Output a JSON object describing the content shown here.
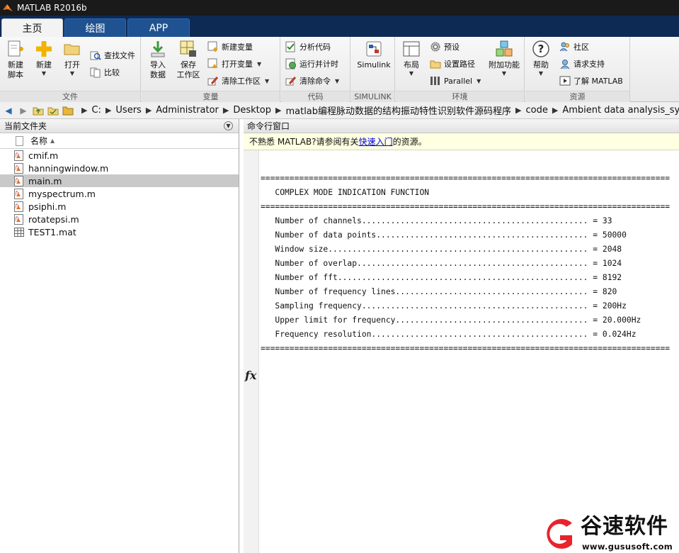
{
  "window": {
    "title": "MATLAB R2016b"
  },
  "tabs": [
    {
      "label": "主页",
      "active": true
    },
    {
      "label": "绘图",
      "active": false
    },
    {
      "label": "APP",
      "active": false
    }
  ],
  "ribbon": {
    "file": {
      "label": "文件",
      "new_script": "新建\n脚本",
      "new": "新建",
      "open": "打开",
      "find_files": "查找文件",
      "compare": "比较"
    },
    "variable": {
      "label": "变量",
      "import": "导入\n数据",
      "save_workspace": "保存\n工作区",
      "new_variable": "新建变量",
      "open_variable": "打开变量",
      "clear_workspace": "清除工作区"
    },
    "code": {
      "label": "代码",
      "analyze": "分析代码",
      "run_time": "运行并计时",
      "clear_commands": "清除命令"
    },
    "simulink": {
      "label": "SIMULINK",
      "simulink": "Simulink"
    },
    "environment": {
      "label": "环境",
      "layout": "布局",
      "preferences": "预设",
      "set_path": "设置路径",
      "parallel": "Parallel",
      "addons": "附加功能"
    },
    "resources": {
      "label": "资源",
      "help": "帮助",
      "community": "社区",
      "support": "请求支持",
      "learn": "了解 MATLAB"
    }
  },
  "path": [
    "C:",
    "Users",
    "Administrator",
    "Desktop",
    "matlab编程脉动数据的结构振动特性识别软件源码程序",
    "code",
    "Ambient data analysis_system ID"
  ],
  "current_folder": {
    "title": "当前文件夹",
    "column_name": "名称",
    "files": [
      {
        "name": "cmif.m",
        "type": "m",
        "selected": false
      },
      {
        "name": "hanningwindow.m",
        "type": "m",
        "selected": false
      },
      {
        "name": "main.m",
        "type": "m",
        "selected": true
      },
      {
        "name": "myspectrum.m",
        "type": "m",
        "selected": false
      },
      {
        "name": "psiphi.m",
        "type": "m",
        "selected": false
      },
      {
        "name": "rotatepsi.m",
        "type": "m",
        "selected": false
      },
      {
        "name": "TEST1.mat",
        "type": "mat",
        "selected": false
      }
    ]
  },
  "command_window": {
    "title": "命令行窗口",
    "notice_prefix": "不熟悉 MATLAB?请参阅有关",
    "notice_link": "快速入门",
    "notice_suffix": "的资源。",
    "prompt": "fx",
    "output": [
      "=====================================================================================",
      "   COMPLEX MODE INDICATION FUNCTION",
      "=====================================================================================",
      "   Number of channels............................................... = 33",
      "   Number of data points............................................ = 50000",
      "   Window size...................................................... = 2048",
      "   Number of overlap................................................ = 1024",
      "   Number of fft.................................................... = 8192",
      "   Number of frequency lines........................................ = 820",
      "   Sampling frequency............................................... = 200Hz",
      "   Upper limit for frequency........................................ = 20.000Hz",
      "   Frequency resolution............................................. = 0.024Hz",
      "====================================================================================="
    ]
  },
  "watermark": {
    "name": "谷速软件",
    "url": "www.gususoft.com"
  },
  "colors": {
    "accent": "#1f5290",
    "tab_strip": "#0d2a55",
    "notice_bg": "#ffffe1",
    "selected_row": "#c9c9c9",
    "brand_red": "#e8232a"
  }
}
